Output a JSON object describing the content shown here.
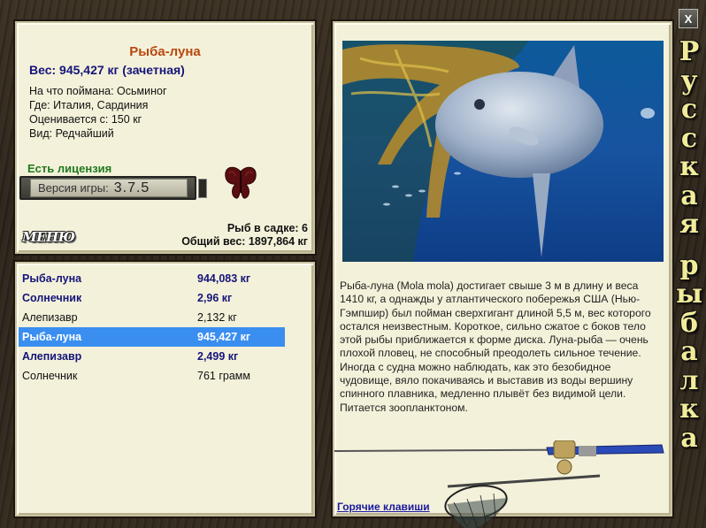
{
  "window": {
    "close_label": "X",
    "side_title_line1": "Русская",
    "side_title_line2": "рыбалка"
  },
  "fish_info": {
    "name": "Рыба-луна",
    "weight_label": "Вес: 945,427 кг (зачетная)",
    "rows": [
      {
        "label": "На что поймана:",
        "value": "Осьминог"
      },
      {
        "label": "Где:",
        "value": "Италия, Сардиния"
      },
      {
        "label": "Оценивается с:",
        "value": "150 кг"
      },
      {
        "label": "Вид:",
        "value": "Редчайший"
      }
    ],
    "license": "Есть лицензия",
    "version_label": "Версия игры:",
    "version_value": "3.7.5",
    "menu_label": "МЕНЮ",
    "fish_in_cage": "Рыб в садке: 6",
    "total_weight": "Общий вес: 1897,864 кг"
  },
  "catch_list": [
    {
      "name": "Рыба-луна",
      "weight": "944,083 кг",
      "style": "bold"
    },
    {
      "name": "Солнечник",
      "weight": "2,96 кг",
      "style": "bold"
    },
    {
      "name": "Алепизавр",
      "weight": "2,132 кг",
      "style": "normal"
    },
    {
      "name": "Рыба-луна",
      "weight": "945,427 кг",
      "style": "selected"
    },
    {
      "name": "Алепизавр",
      "weight": "2,499 кг",
      "style": "bold"
    },
    {
      "name": "Солнечник",
      "weight": "761 грамм",
      "style": "normal"
    }
  ],
  "description": {
    "text": "Рыба-луна (Mola mola) достигает свыше 3 м в длину и веса 1410 кг, а однажды у атлантического побережья США (Нью-Гэмпшир) был пойман сверхгигант длиной 5,5 м, вес которого остался неизвестным. Короткое, сильно сжатое с боков тело этой рыбы приближается к форме диска. Луна-рыба — очень плохой пловец, не способный преодолеть сильное течение. Иногда с судна можно наблюдать, как это безобидное чудовище, вяло покачиваясь и выставив из воды вершину спинного плавника, медленно плывёт без видимой цели. Питается зоопланктоном.",
    "hotkeys_link": "Горячие клавиши"
  },
  "colors": {
    "fish_title": "#b8480f",
    "weight_blue": "#15157a",
    "license_green": "#1f7a1f",
    "selection": "#3a8ef0",
    "title_letters": "#f2ec9a"
  }
}
